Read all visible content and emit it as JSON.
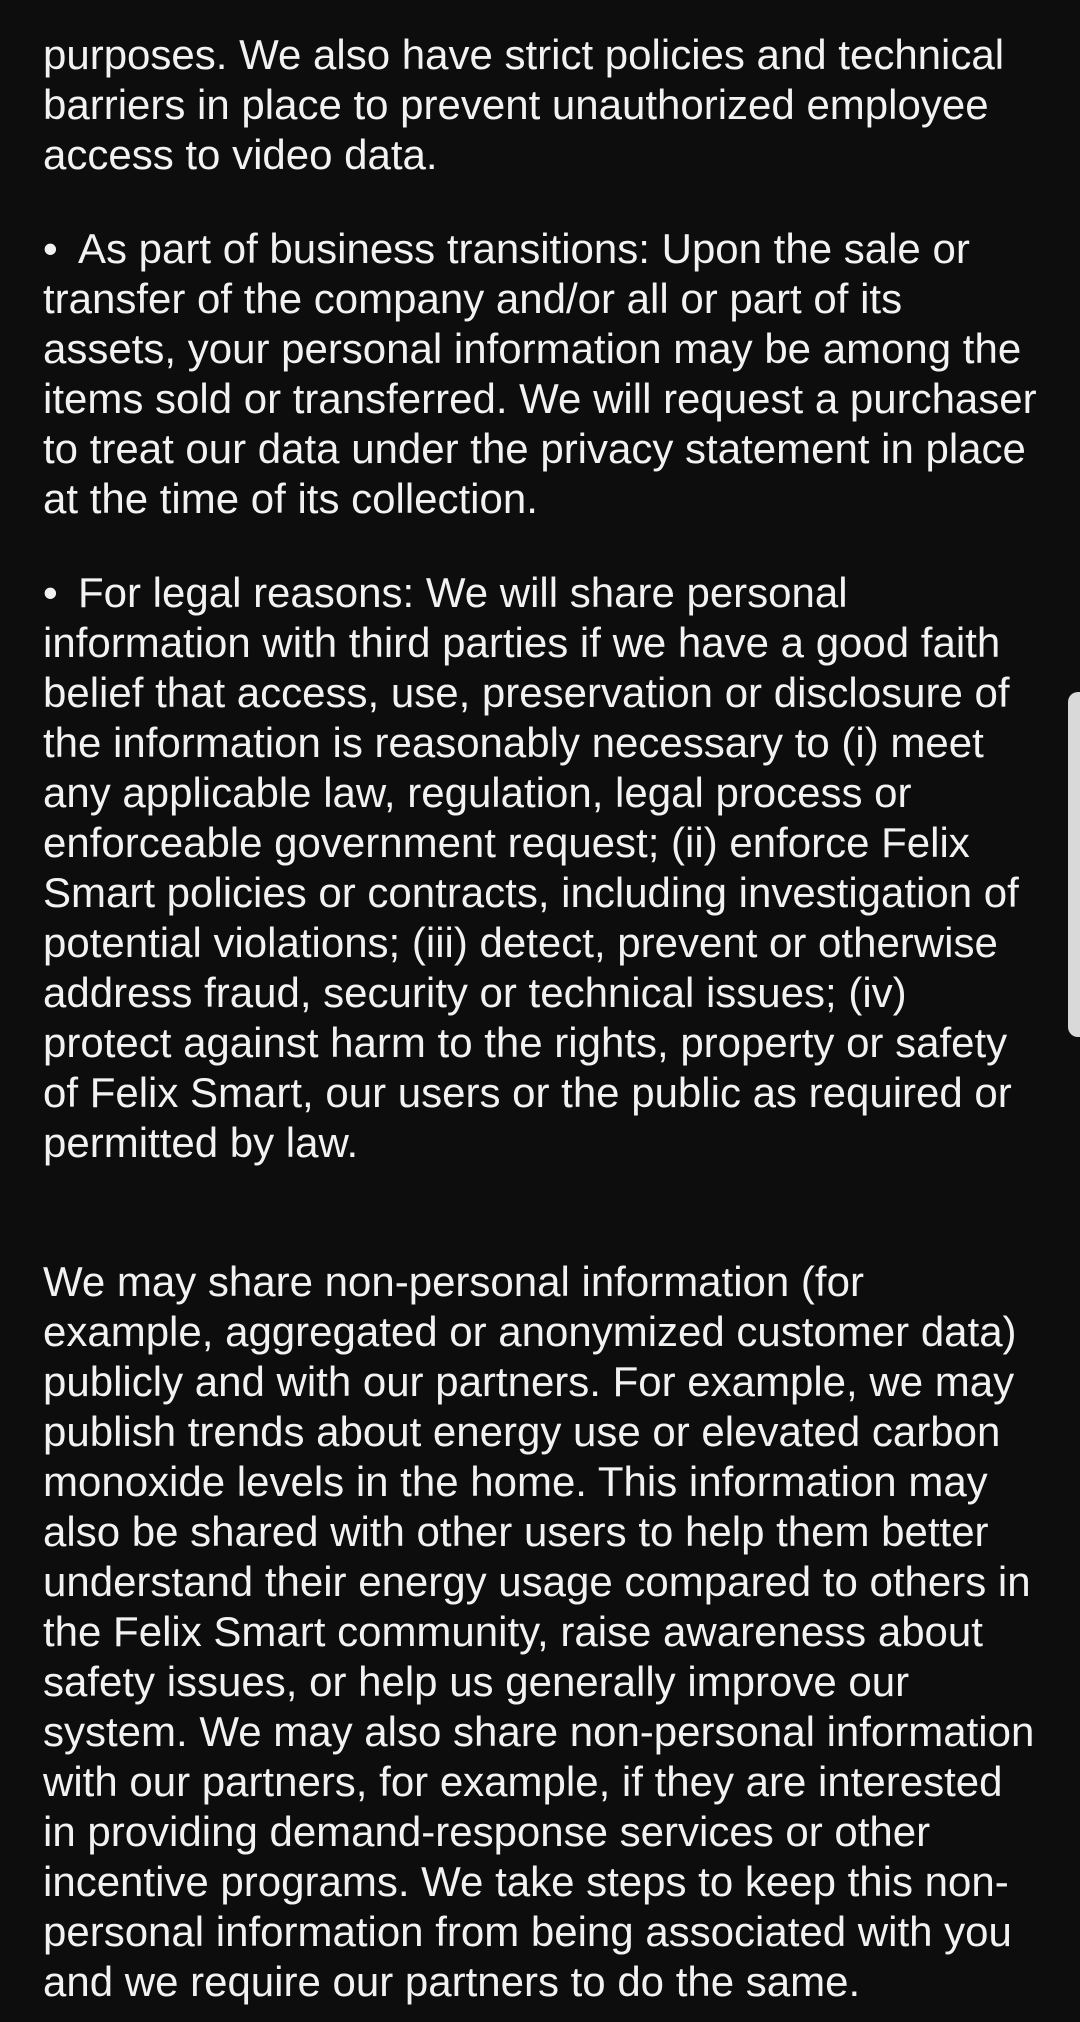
{
  "document": {
    "paragraph_intro_tail": "purposes. We also have strict policies and technical barriers in place to prevent unauthorized employee access to video data.",
    "bullet_symbol": "•",
    "bullet_business": "As part of business transitions: Upon the sale or transfer of the company and/or all or part of its assets, your personal information may be among the items sold or transferred. We will request a purchaser to treat our data under the privacy statement in place at the time of its collection.",
    "bullet_legal": "For legal reasons: We will share personal information with third parties if we have a good faith belief that access, use, preservation or disclosure of the information is reasonably necessary to (i) meet any applicable law, regulation, legal process or enforceable government request; (ii) enforce Felix Smart policies or contracts, including investigation of potential violations; (iii) detect, prevent or otherwise address fraud, security or technical issues; (iv) protect against harm to the rights, property or safety of Felix Smart, our users or the public as required or permitted by law.",
    "paragraph_non_personal": "We may share non-personal information (for example, aggregated or anonymized customer data) publicly and with our partners. For example, we may publish trends about energy use or elevated carbon monoxide levels in the home. This information may also be shared with other users to help them better understand their energy usage compared to others in the Felix Smart community, raise awareness about safety issues, or help us generally improve our system. We may also share non-personal information with our partners, for example, if they are interested in providing demand-response services or other incentive programs. We take steps to keep this non-personal information from being associated with you and we require our partners to do the same."
  },
  "scrollbar": {
    "position_fraction": 0.5
  }
}
